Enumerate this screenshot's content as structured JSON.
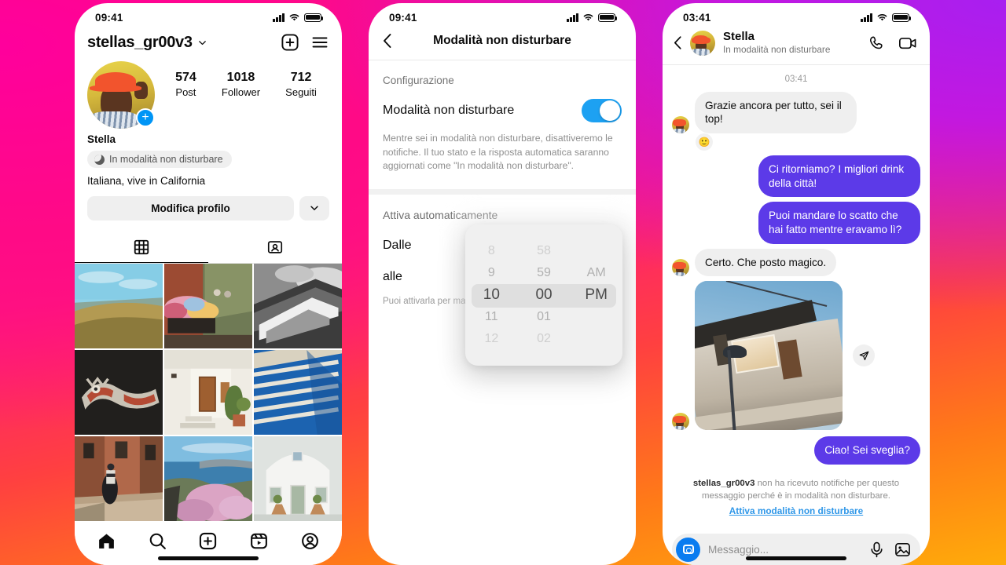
{
  "phones": {
    "profile": {
      "status": {
        "time": "09:41",
        "signal_icon": "signal-bars-icon",
        "wifi_icon": "wifi-icon",
        "battery_icon": "battery-icon"
      },
      "header": {
        "username": "stellas_gr00v3",
        "chevron_icon": "chevron-down-icon",
        "add_icon": "plus-square-icon",
        "menu_icon": "hamburger-menu-icon"
      },
      "avatar": {
        "add_badge": "+",
        "name": "avatar"
      },
      "stats": [
        {
          "value": "574",
          "label": "Post"
        },
        {
          "value": "1018",
          "label": "Follower"
        },
        {
          "value": "712",
          "label": "Seguiti"
        }
      ],
      "bio": {
        "name": "Stella",
        "dnd_chip": "In modalità non disturbare",
        "moon_icon": "moon-icon",
        "description": "Italiana, vive in California"
      },
      "actions": {
        "edit_profile": "Modifica profilo",
        "chevron_icon": "chevron-down-icon"
      },
      "tabs": [
        {
          "icon": "grid-icon",
          "active": true
        },
        {
          "icon": "tagged-person-icon",
          "active": false
        }
      ],
      "grid_alt": [
        "hillside-landscape",
        "brick-house-flowers",
        "bw-building-cornice",
        "dark-mosaic-creature",
        "white-greek-house",
        "blue-pergola-shadows",
        "venice-canal-steps",
        "santorini-sea-flowers",
        "white-church-door"
      ],
      "tabbar": [
        {
          "icon": "home-icon",
          "label": "Home"
        },
        {
          "icon": "search-icon",
          "label": "Cerca"
        },
        {
          "icon": "plus-square-icon",
          "label": "Crea"
        },
        {
          "icon": "reels-icon",
          "label": "Reels"
        },
        {
          "icon": "profile-circle-icon",
          "label": "Profilo"
        }
      ]
    },
    "settings": {
      "status": {
        "time": "09:41"
      },
      "navbar": {
        "back_icon": "back-chevron-icon",
        "title": "Modalità non disturbare"
      },
      "section_label": "Configurazione",
      "toggle_row": {
        "label": "Modalità non disturbare",
        "toggle_on": true,
        "accent": "#1da1f2"
      },
      "help_text": "Mentre sei in modalità non disturbare, disattiveremo le notifiche. Il tuo stato e la risposta automatica saranno aggiornati come \"In modalità non disturbare\".",
      "auto_label": "Attiva automaticamente",
      "from_label": "Dalle",
      "to_label": "alle",
      "note_text": "Puoi attivarla per mas",
      "picker": {
        "hours": [
          "8",
          "9",
          "10",
          "11",
          "12"
        ],
        "minutes": [
          "58",
          "59",
          "00",
          "01",
          "02"
        ],
        "meridiem": [
          "",
          "AM",
          "PM",
          "",
          ""
        ],
        "selected_hour": "10",
        "selected_minute": "00",
        "selected_meridiem": "PM"
      }
    },
    "chat": {
      "status": {
        "time": "03:41"
      },
      "navbar": {
        "back_icon": "back-chevron-icon",
        "name": "Stella",
        "subtitle": "In modalità non disturbare",
        "call_icon": "phone-call-icon",
        "video_icon": "video-camera-icon"
      },
      "timestamp": "03:41",
      "messages": [
        {
          "dir": "in",
          "text": "Grazie ancora per tutto, sei il top!",
          "reaction": "🙂",
          "avatar": true
        },
        {
          "dir": "out",
          "text": "Ci ritorniamo? I migliori drink della città!"
        },
        {
          "dir": "out",
          "text": "Puoi mandare lo scatto che hai fatto mentre eravamo lì?"
        },
        {
          "dir": "in",
          "text": "Certo. Che posto magico.",
          "avatar": true
        },
        {
          "dir": "in",
          "type": "photo",
          "alt": "golden-hour-building-window",
          "send_icon": "send-arrow-icon",
          "avatar": true
        },
        {
          "dir": "out",
          "text": "Ciao! Sei sveglia?"
        }
      ],
      "system_note": {
        "username": "stellas_gr00v3",
        "text": " non ha ricevuto notifiche per questo messaggio perché è in modalità non disturbare.",
        "link": "Attiva modalità non disturbare",
        "link_color": "#2f97e8"
      },
      "composer": {
        "camera_icon": "camera-icon",
        "placeholder": "Messaggio...",
        "mic_icon": "microphone-icon",
        "gallery_icon": "image-gallery-icon"
      }
    }
  },
  "theme": {
    "bubble_out": "#5c3ae8",
    "toggle_on": "#1da1f2",
    "link": "#2f97e8",
    "badge_blue": "#0095f6"
  }
}
